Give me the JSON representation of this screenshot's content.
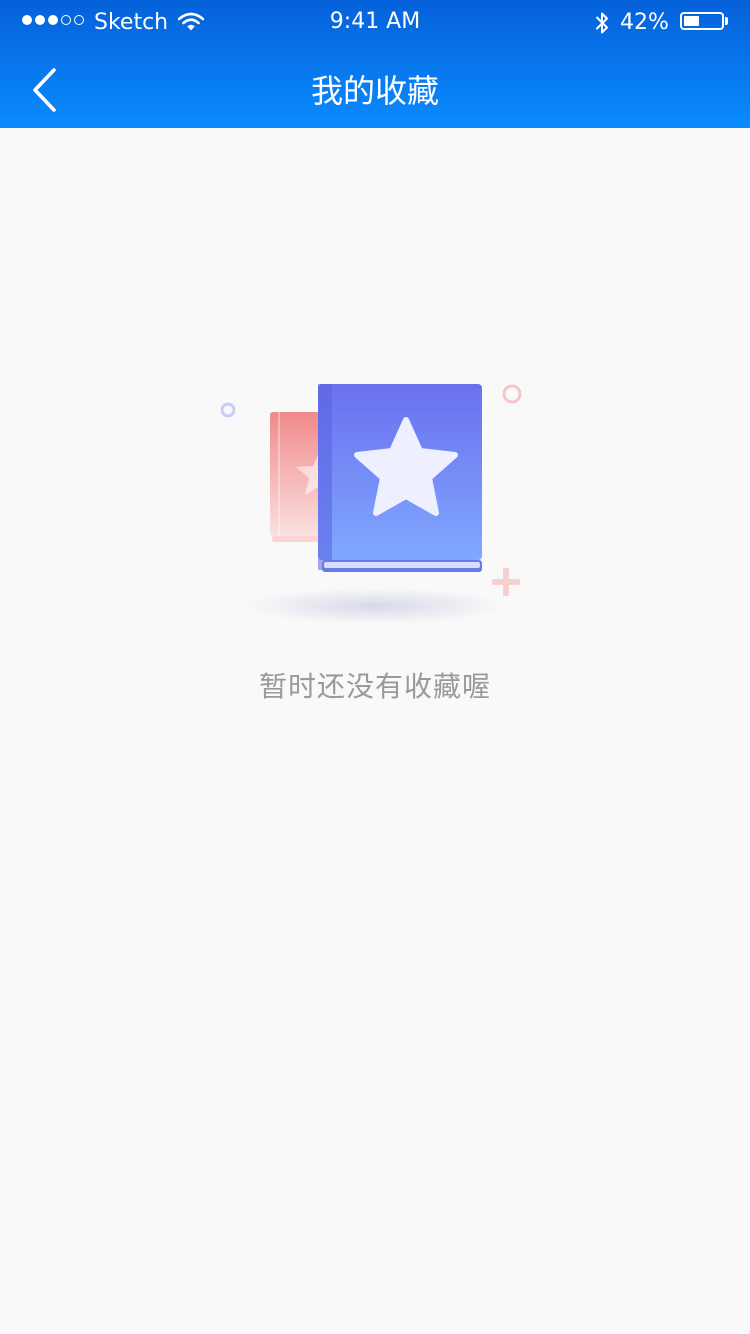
{
  "status_bar": {
    "signal_filled": 3,
    "signal_total": 5,
    "carrier": "Sketch",
    "time": "9:41 AM",
    "battery_percent_text": "42%",
    "battery_level": 0.42
  },
  "nav": {
    "title": "我的收藏",
    "back_icon": "chevron-left-icon"
  },
  "empty_state": {
    "message": "暂时还没有收藏喔",
    "illustration_icon": "favorite-book-star-icon"
  },
  "colors": {
    "header_top": "#0561d9",
    "header_bottom": "#0a8bff",
    "background": "#f9f9f9",
    "message_text": "#9a9a9a",
    "book_front_top": "#6a70ee",
    "book_front_bottom": "#80a8ff",
    "book_back": "#f08a8a"
  }
}
